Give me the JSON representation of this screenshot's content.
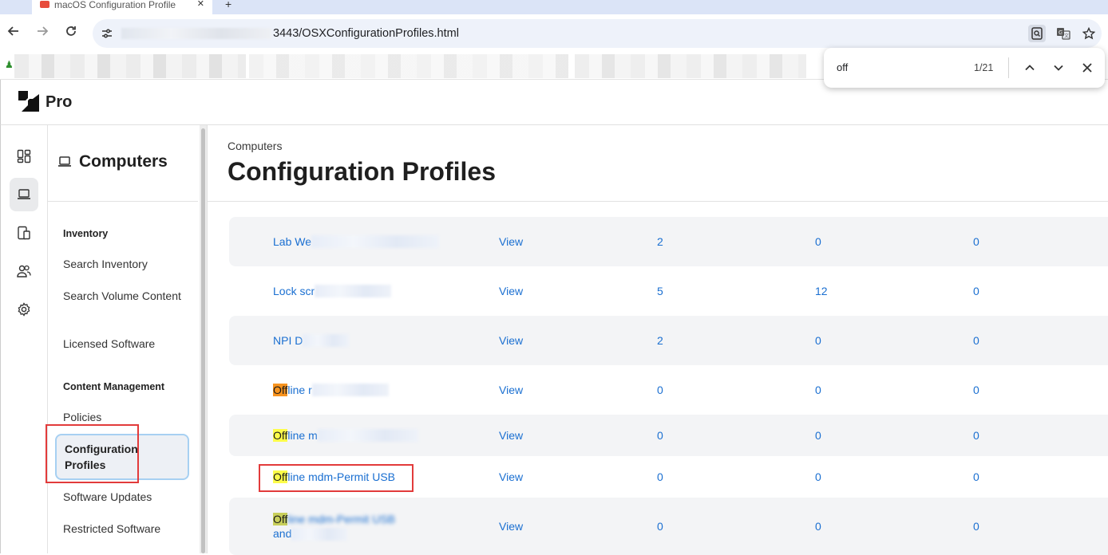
{
  "browser": {
    "tab_title": "macOS Configuration Profile",
    "tab_close": "✕",
    "new_tab": "+",
    "url_visible": "3443/OSXConfigurationProfiles.html",
    "find": {
      "query": "off",
      "count": "1/21"
    }
  },
  "app": {
    "logo_text": "Pro"
  },
  "rail": {
    "items": [
      "dashboard-icon",
      "computer-icon",
      "devices-icon",
      "users-icon",
      "settings-icon"
    ],
    "active": "computer-icon"
  },
  "sidenav": {
    "title": "Computers",
    "sections": [
      {
        "heading": "Inventory",
        "items": [
          "Search Inventory",
          "Search Volume Content",
          "Licensed Software"
        ]
      },
      {
        "heading": "Content Management",
        "items": [
          "Policies",
          "Configuration Profiles",
          "Software Updates",
          "Restricted Software"
        ]
      }
    ],
    "active_item": "Configuration Profiles"
  },
  "main": {
    "breadcrumb": "Computers",
    "title": "Configuration Profiles",
    "view_label": "View",
    "rows": [
      {
        "name_visible": "Lab We",
        "view": "View",
        "col_a": "2",
        "col_b": "0",
        "col_c": "0"
      },
      {
        "name_visible": "Lock scr",
        "view": "View",
        "col_a": "5",
        "col_b": "12",
        "col_c": "0"
      },
      {
        "name_visible": "NPI D",
        "view": "View",
        "col_a": "2",
        "col_b": "0",
        "col_c": "0"
      },
      {
        "name_match": "Off",
        "name_rest": "line r",
        "view": "View",
        "col_a": "0",
        "col_b": "0",
        "col_c": "0"
      },
      {
        "name_match": "Off",
        "name_rest": "line m",
        "view": "View",
        "col_a": "0",
        "col_b": "0",
        "col_c": "0"
      },
      {
        "name_match": "Off",
        "name_rest": "line mdm-Permit USB",
        "view": "View",
        "col_a": "0",
        "col_b": "0",
        "col_c": "0"
      },
      {
        "name_match": "Off",
        "name_rest": "line mdm-Permit USB",
        "name_line2": "and",
        "view": "View",
        "col_a": "0",
        "col_b": "0",
        "col_c": "0"
      }
    ]
  },
  "colors": {
    "link": "#1a6fd1",
    "highlight": "#fdfd4a",
    "highlight_current": "#f7931e",
    "annotation": "#e23b3b",
    "active_border": "#a7d0f2"
  }
}
